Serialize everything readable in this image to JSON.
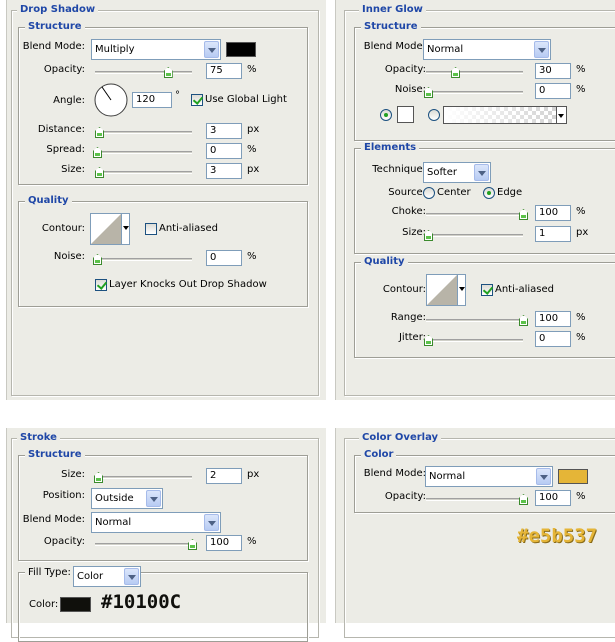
{
  "drop_shadow": {
    "title": "Drop Shadow",
    "structure": {
      "legend": "Structure",
      "blend_mode_label": "Blend Mode:",
      "blend_mode": "Multiply",
      "color": "#000000",
      "opacity_label": "Opacity:",
      "opacity": "75",
      "opacity_unit": "%",
      "opacity_level": 0.75,
      "angle_label": "Angle:",
      "angle": "120",
      "angle_unit": "°",
      "global_light_label": "Use Global Light",
      "global_light": true,
      "distance_label": "Distance:",
      "distance": "3",
      "distance_unit": "px",
      "spread_label": "Spread:",
      "spread": "0",
      "spread_unit": "%",
      "size_label": "Size:",
      "size": "3",
      "size_unit": "px"
    },
    "quality": {
      "legend": "Quality",
      "contour_label": "Contour:",
      "anti_aliased_label": "Anti-aliased",
      "anti_aliased": false,
      "noise_label": "Noise:",
      "noise": "0",
      "noise_unit": "%",
      "knocks_out_label": "Layer Knocks Out Drop Shadow",
      "knocks_out": true
    }
  },
  "inner_glow": {
    "title": "Inner Glow",
    "structure": {
      "legend": "Structure",
      "blend_mode_label": "Blend Mode:",
      "blend_mode": "Normal",
      "opacity_label": "Opacity:",
      "opacity": "30",
      "opacity_unit": "%",
      "opacity_level": 0.3,
      "noise_label": "Noise:",
      "noise": "0",
      "noise_unit": "%",
      "color": "#ffffff",
      "mode": "color"
    },
    "elements": {
      "legend": "Elements",
      "technique_label": "Technique:",
      "technique": "Softer",
      "source_label": "Source:",
      "center_label": "Center",
      "edge_label": "Edge",
      "source": "edge",
      "choke_label": "Choke:",
      "choke": "100",
      "choke_unit": "%",
      "size_label": "Size:",
      "size": "1",
      "size_unit": "px"
    },
    "quality": {
      "legend": "Quality",
      "contour_label": "Contour:",
      "anti_aliased_label": "Anti-aliased",
      "anti_aliased": true,
      "range_label": "Range:",
      "range": "100",
      "range_unit": "%",
      "jitter_label": "Jitter:",
      "jitter": "0",
      "jitter_unit": "%"
    }
  },
  "stroke": {
    "title": "Stroke",
    "structure": {
      "legend": "Structure",
      "size_label": "Size:",
      "size": "2",
      "size_unit": "px",
      "position_label": "Position:",
      "position": "Outside",
      "blend_mode_label": "Blend Mode:",
      "blend_mode": "Normal",
      "opacity_label": "Opacity:",
      "opacity": "100",
      "opacity_unit": "%"
    },
    "fill": {
      "fill_type_label": "Fill Type:",
      "fill_type": "Color",
      "color_label": "Color:",
      "color": "#10100c",
      "color_hex_label": "#10100C"
    }
  },
  "color_overlay": {
    "title": "Color Overlay",
    "color": {
      "legend": "Color",
      "blend_mode_label": "Blend Mode:",
      "blend_mode": "Normal",
      "color": "#e5b537",
      "opacity_label": "Opacity:",
      "opacity": "100",
      "opacity_unit": "%"
    },
    "color_hex_label": "#e5b537"
  }
}
